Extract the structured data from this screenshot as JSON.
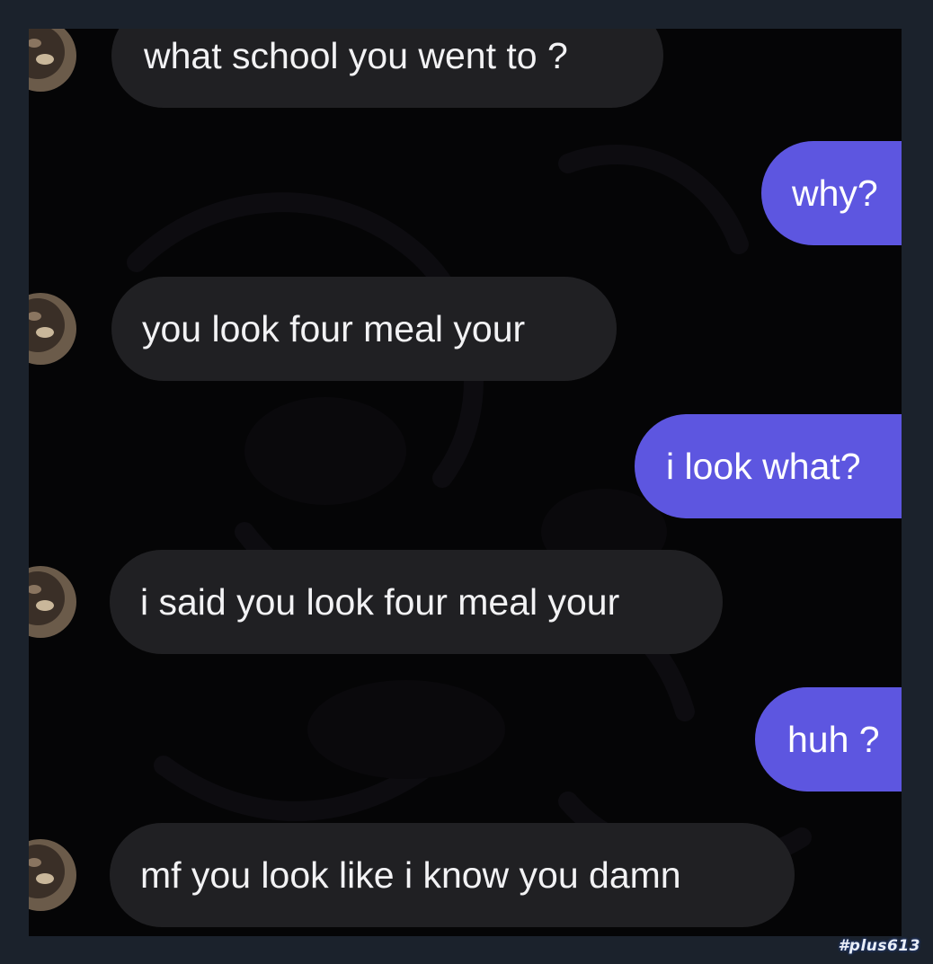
{
  "conversation": {
    "messages": [
      {
        "sender": "them",
        "text": "what school you went to ?"
      },
      {
        "sender": "me",
        "text": "why?"
      },
      {
        "sender": "them",
        "text": "you look four meal your"
      },
      {
        "sender": "me",
        "text": "i look what?"
      },
      {
        "sender": "them",
        "text": "i said you look four meal your"
      },
      {
        "sender": "me",
        "text": "huh ?"
      },
      {
        "sender": "them",
        "text": "mf you look like i know you damn"
      }
    ]
  },
  "watermark": {
    "text": "#plus613"
  },
  "colors": {
    "incoming_bubble": "#202023",
    "outgoing_bubble": "#5d56e0",
    "chat_background": "#050506",
    "frame": "#1b222c"
  },
  "icons": {
    "avatar": "contact-avatar-icon"
  }
}
